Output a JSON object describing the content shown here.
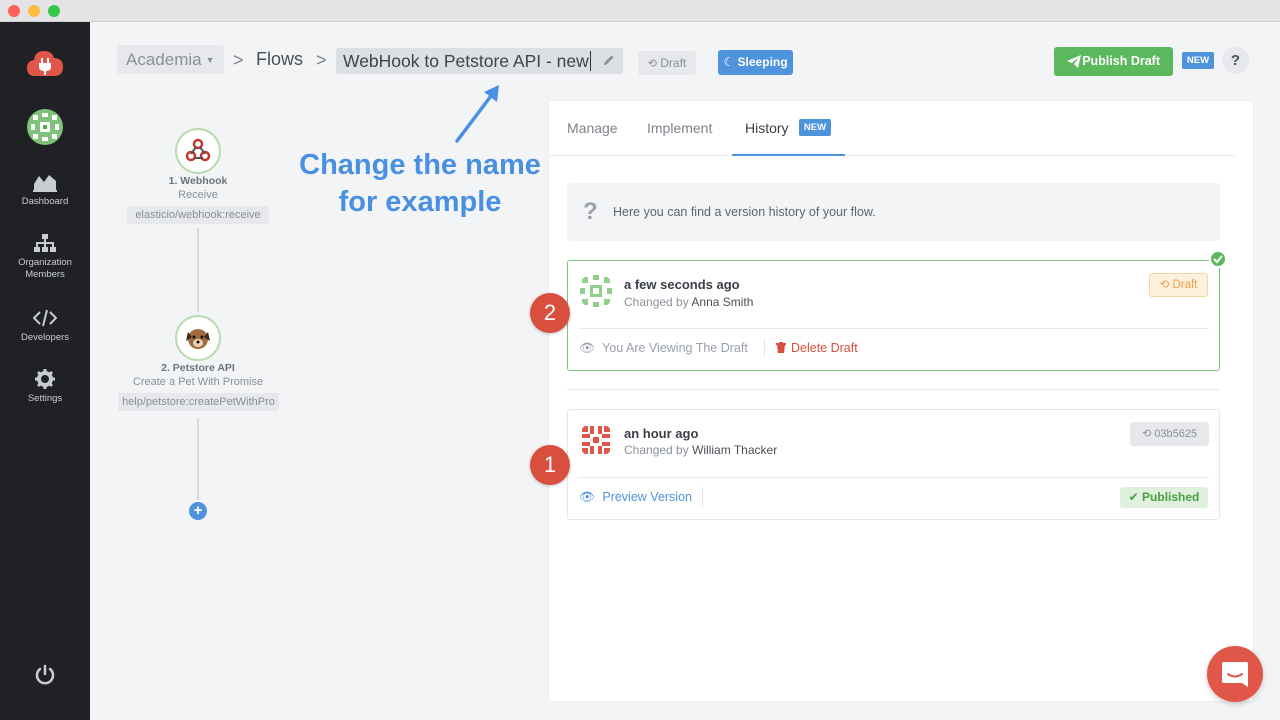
{
  "header": {
    "org": "Academia",
    "separator": ">",
    "flows": "Flows",
    "flow_name": "WebHook to Petstore API - new",
    "draft_label": "Draft",
    "sleeping_label": "Sleeping",
    "publish_label": "Publish Draft",
    "new_badge": "NEW",
    "help": "?"
  },
  "sidebar": {
    "items": [
      {
        "label": "Dashboard",
        "icon": "dashboard-icon"
      },
      {
        "label": "Organization Members",
        "icon": "org-members-icon"
      },
      {
        "label": "Developers",
        "icon": "code-icon"
      },
      {
        "label": "Settings",
        "icon": "gear-icon"
      }
    ]
  },
  "flow": {
    "steps": [
      {
        "title": "1. Webhook",
        "subtitle": "Receive",
        "code": "elasticio/webhook:receive"
      },
      {
        "title": "2. Petstore API",
        "subtitle": "Create a Pet With Promise",
        "code": "help/petstore:createPetWithPro"
      }
    ]
  },
  "annotation": {
    "line1": "Change the name",
    "line2": "for example"
  },
  "panel": {
    "tabs": [
      {
        "label": "Manage"
      },
      {
        "label": "Implement"
      },
      {
        "label": "History"
      }
    ],
    "history_new": "NEW",
    "info": "Here you can find a version history of your flow.",
    "info_icon": "?"
  },
  "versions": [
    {
      "when": "a few seconds ago",
      "changed_by_prefix": "Changed by",
      "author": "Anna Smith",
      "tag": "Draft",
      "action1": "You Are Viewing The Draft",
      "action2": "Delete Draft",
      "badge": "2"
    },
    {
      "when": "an hour ago",
      "changed_by_prefix": "Changed by",
      "author": "William Thacker",
      "tag": "03b5625",
      "action1": "Preview Version",
      "status": "Published",
      "badge": "1"
    }
  ],
  "colors": {
    "sidebar_bg": "#1f2125",
    "accent_blue": "#4f93dd",
    "publish_green": "#5cb85c",
    "badge_red": "#d8503d",
    "annotation_blue": "#4a90e2"
  }
}
